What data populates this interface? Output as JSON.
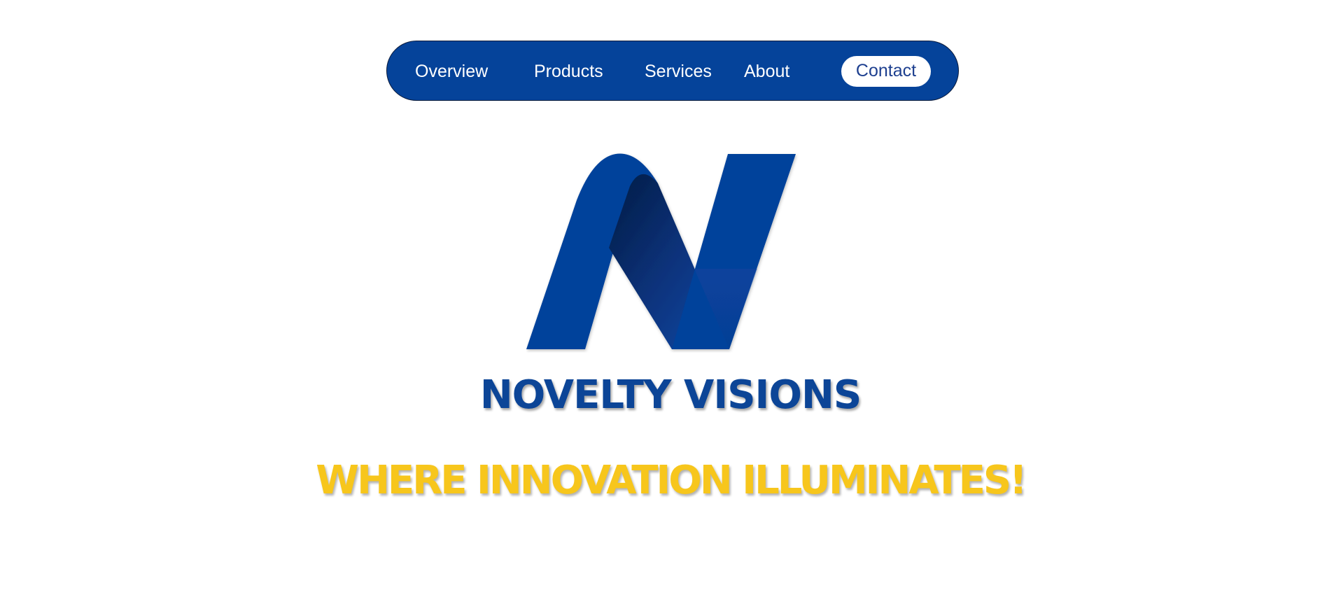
{
  "nav": {
    "items": [
      {
        "label": "Overview"
      },
      {
        "label": "Products"
      },
      {
        "label": "Services"
      },
      {
        "label": "About"
      },
      {
        "label": "Contact"
      }
    ],
    "active": "Contact"
  },
  "hero": {
    "logo_icon": "stylized-n-ribbon-logo",
    "brand_name": "NOVELTY VISIONS",
    "tagline": "WHERE INNOVATION ILLUMINATES!"
  },
  "colors": {
    "nav_background": "#05439a",
    "brand_blue": "#0c4597",
    "tagline_yellow": "#f7c61c",
    "page_background": "#ffffff"
  }
}
